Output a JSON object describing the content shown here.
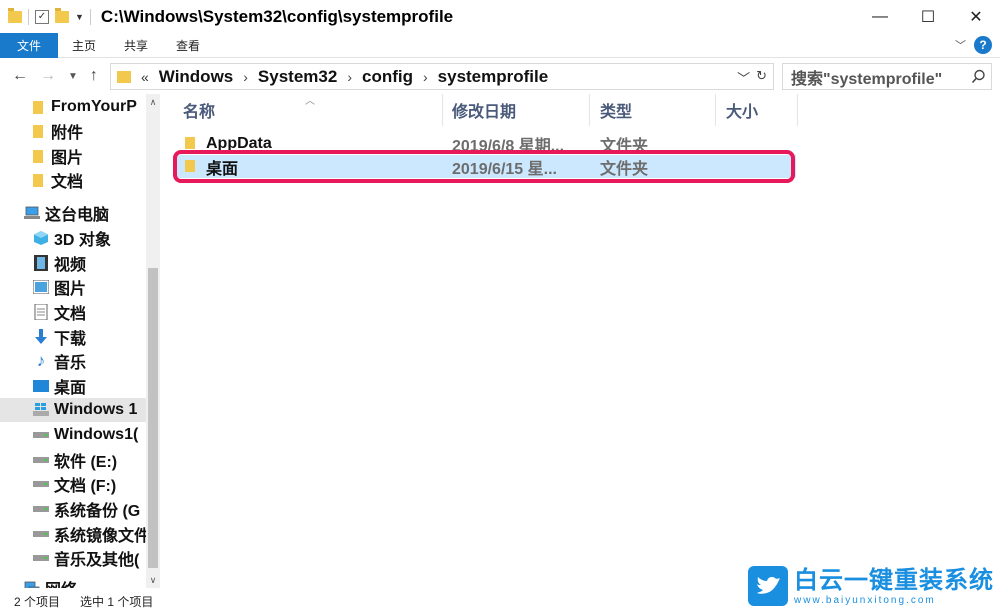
{
  "window": {
    "title": "C:\\Windows\\System32\\config\\systemprofile",
    "minimize_glyph": "—",
    "maximize_glyph": "☐",
    "close_glyph": "✕"
  },
  "ribbon": {
    "tabs": [
      "文件",
      "主页",
      "共享",
      "查看"
    ],
    "help_glyph": "?"
  },
  "address": {
    "overflow": "«",
    "crumbs": [
      "Windows",
      "System32",
      "config",
      "systemprofile"
    ],
    "search_placeholder": "搜索\"systemprofile\""
  },
  "sidebar": {
    "items": [
      {
        "label": "FromYourP",
        "icon": "folder-icon"
      },
      {
        "label": "附件",
        "icon": "folder-icon"
      },
      {
        "label": "图片",
        "icon": "folder-icon"
      },
      {
        "label": "文档",
        "icon": "folder-icon"
      },
      {
        "label": "这台电脑",
        "icon": "computer-icon"
      },
      {
        "label": "3D 对象",
        "icon": "cube-icon"
      },
      {
        "label": "视频",
        "icon": "video-icon"
      },
      {
        "label": "图片",
        "icon": "pictures-icon"
      },
      {
        "label": "文档",
        "icon": "documents-icon"
      },
      {
        "label": "下载",
        "icon": "download-icon"
      },
      {
        "label": "音乐",
        "icon": "music-icon"
      },
      {
        "label": "桌面",
        "icon": "desktop-icon"
      },
      {
        "label": "Windows 1",
        "icon": "windows-drive-icon"
      },
      {
        "label": "Windows1(",
        "icon": "drive-icon"
      },
      {
        "label": "软件 (E:)",
        "icon": "drive-icon"
      },
      {
        "label": "文档 (F:)",
        "icon": "drive-icon"
      },
      {
        "label": "系统备份 (G",
        "icon": "drive-icon"
      },
      {
        "label": "系统镜像文件",
        "icon": "drive-icon"
      },
      {
        "label": "音乐及其他(",
        "icon": "drive-icon"
      },
      {
        "label": "网络",
        "icon": "network-icon"
      }
    ]
  },
  "columns": {
    "name": "名称",
    "date": "修改日期",
    "type": "类型",
    "size": "大小"
  },
  "files": [
    {
      "name": "AppData",
      "date": "2019/6/8 星期...",
      "type": "文件夹"
    },
    {
      "name": "桌面",
      "date": "2019/6/15 星...",
      "type": "文件夹"
    }
  ],
  "status": {
    "count": "2 个项目",
    "selected": "选中 1 个项目"
  },
  "watermark": {
    "brand": "白云一键重装系统",
    "url": "www.baiyunxitong.com"
  }
}
